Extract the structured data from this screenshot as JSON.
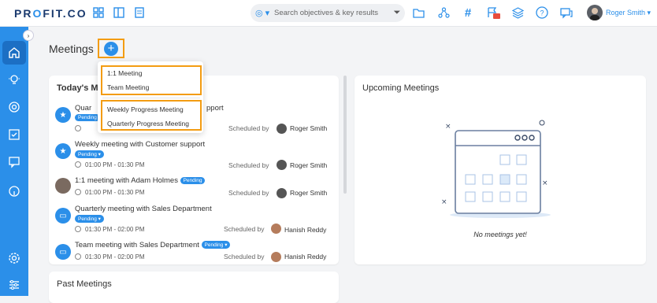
{
  "app": {
    "logo": "PROFIT.CO"
  },
  "header": {
    "search_placeholder": "Search objectives & key results",
    "user_name": "Roger Smith"
  },
  "page": {
    "title": "Meetings",
    "add_symbol": "+"
  },
  "dropdown": {
    "items": [
      "1:1 Meeting",
      "Team Meeting",
      "Weekly Progress Meeting",
      "Quarterly Progress Meeting"
    ]
  },
  "today": {
    "title": "Today's M",
    "meetings": [
      {
        "title": "Quar",
        "title_end": "pport",
        "badge": "Pending",
        "time": "",
        "scheduled_by": "Scheduled by",
        "person": "Roger Smith"
      },
      {
        "title": "Weekly meeting with Customer support",
        "badge": "Pending",
        "time": "01:00 PM - 01:30 PM",
        "scheduled_by": "Scheduled by",
        "person": "Roger Smith"
      },
      {
        "title": "1:1 meeting with Adam Holmes",
        "badge": "Pending",
        "time": "01:00 PM - 01:30 PM",
        "scheduled_by": "Scheduled by",
        "person": "Roger Smith"
      },
      {
        "title": "Quarterly meeting with Sales Department",
        "badge": "Pending",
        "time": "01:30 PM - 02:00 PM",
        "scheduled_by": "Scheduled by",
        "person": "Hanish Reddy"
      },
      {
        "title": "Team meeting with Sales Department",
        "badge": "Pending",
        "time": "01:30 PM - 02:00 PM",
        "scheduled_by": "Scheduled by",
        "person": "Hanish Reddy"
      }
    ]
  },
  "upcoming": {
    "title": "Upcoming Meetings",
    "empty_text": "No meetings yet!"
  },
  "past": {
    "title": "Past Meetings"
  },
  "colors": {
    "accent": "#2b8fe9",
    "highlight": "#f39c12",
    "sidebar": "#2b8fe9"
  }
}
